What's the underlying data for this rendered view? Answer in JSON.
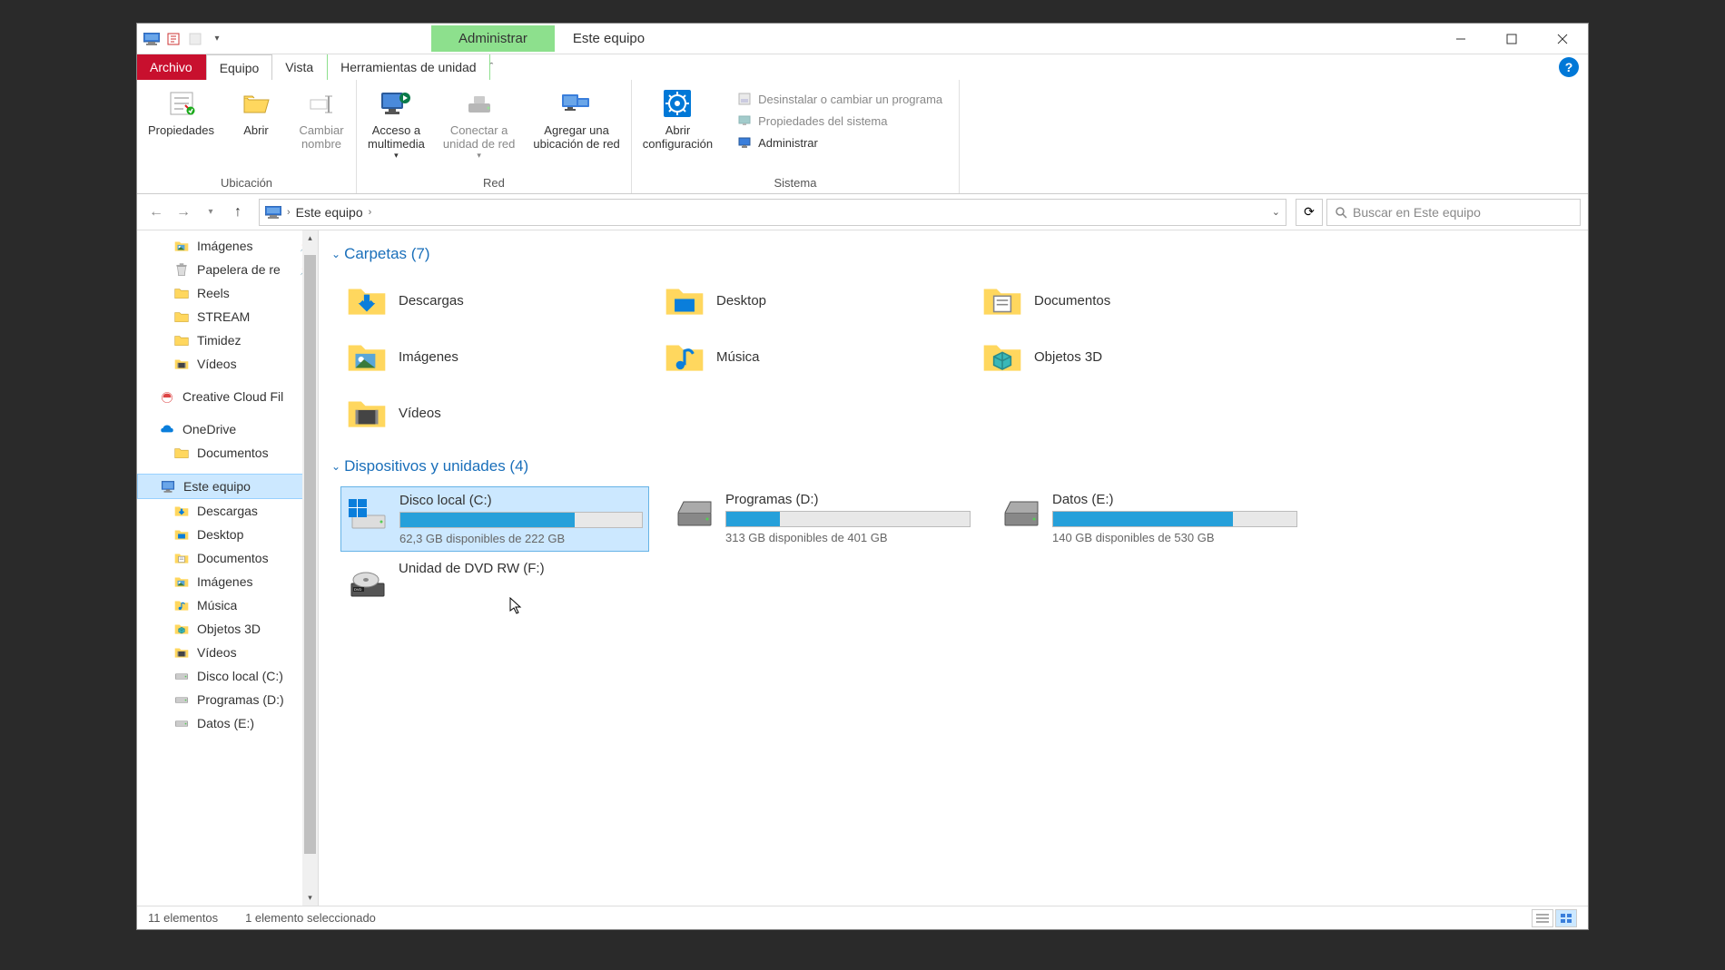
{
  "titlebar": {
    "context_tab": "Administrar",
    "title": "Este equipo"
  },
  "tabs": {
    "archivo": "Archivo",
    "equipo": "Equipo",
    "vista": "Vista",
    "herramientas": "Herramientas de unidad"
  },
  "ribbon": {
    "propiedades": "Propiedades",
    "abrir": "Abrir",
    "cambiar": "Cambiar\nnombre",
    "ubicacion_label": "Ubicación",
    "acceso": "Acceso a\nmultimedia",
    "conectar": "Conectar a\nunidad de red",
    "agregar": "Agregar una\nubicación de red",
    "red_label": "Red",
    "abrir_config": "Abrir\nconfiguración",
    "desinstalar": "Desinstalar o cambiar un programa",
    "propiedades_sistema": "Propiedades del sistema",
    "administrar": "Administrar",
    "sistema_label": "Sistema"
  },
  "nav": {
    "location": "Este equipo",
    "search_placeholder": "Buscar en Este equipo"
  },
  "sidebar": {
    "items": [
      {
        "label": "Imágenes",
        "icon": "pictures",
        "indent": 1,
        "pin": true
      },
      {
        "label": "Papelera de re",
        "icon": "recycle",
        "indent": 1,
        "pin": true
      },
      {
        "label": "Reels",
        "icon": "folder",
        "indent": 1
      },
      {
        "label": "STREAM",
        "icon": "folder",
        "indent": 1
      },
      {
        "label": "Timidez",
        "icon": "folder",
        "indent": 1
      },
      {
        "label": "Vídeos",
        "icon": "videos",
        "indent": 1
      },
      {
        "label": "Creative Cloud Fil",
        "icon": "cc",
        "indent": 0
      },
      {
        "label": "OneDrive",
        "icon": "onedrive",
        "indent": 0
      },
      {
        "label": "Documentos",
        "icon": "folder",
        "indent": 1
      },
      {
        "label": "Este equipo",
        "icon": "pc",
        "indent": 0,
        "selected": true
      },
      {
        "label": "Descargas",
        "icon": "downloads",
        "indent": 1
      },
      {
        "label": "Desktop",
        "icon": "desktop",
        "indent": 1
      },
      {
        "label": "Documentos",
        "icon": "documents",
        "indent": 1
      },
      {
        "label": "Imágenes",
        "icon": "pictures",
        "indent": 1
      },
      {
        "label": "Música",
        "icon": "music",
        "indent": 1
      },
      {
        "label": "Objetos 3D",
        "icon": "3d",
        "indent": 1
      },
      {
        "label": "Vídeos",
        "icon": "videos",
        "indent": 1
      },
      {
        "label": "Disco local (C:)",
        "icon": "drive",
        "indent": 1
      },
      {
        "label": "Programas (D:)",
        "icon": "drive",
        "indent": 1
      },
      {
        "label": "Datos (E:)",
        "icon": "drive",
        "indent": 1
      }
    ]
  },
  "content": {
    "folders_header": "Carpetas (7)",
    "folders": [
      {
        "label": "Descargas",
        "icon": "downloads"
      },
      {
        "label": "Desktop",
        "icon": "desktop"
      },
      {
        "label": "Documentos",
        "icon": "documents"
      },
      {
        "label": "Imágenes",
        "icon": "pictures"
      },
      {
        "label": "Música",
        "icon": "music"
      },
      {
        "label": "Objetos 3D",
        "icon": "3d"
      },
      {
        "label": "Vídeos",
        "icon": "videos"
      }
    ],
    "devices_header": "Dispositivos y unidades (4)",
    "drives": [
      {
        "label": "Disco local (C:)",
        "status": "62,3 GB disponibles de 222 GB",
        "fill": 72,
        "selected": true,
        "icon": "os"
      },
      {
        "label": "Programas (D:)",
        "status": "313 GB disponibles de 401 GB",
        "fill": 22,
        "icon": "hdd"
      },
      {
        "label": "Datos (E:)",
        "status": "140 GB disponibles de 530 GB",
        "fill": 74,
        "icon": "hdd"
      },
      {
        "label": "Unidad de DVD RW (F:)",
        "status": "",
        "fill": 0,
        "icon": "dvd"
      }
    ]
  },
  "statusbar": {
    "count": "11 elementos",
    "selection": "1 elemento seleccionado"
  }
}
